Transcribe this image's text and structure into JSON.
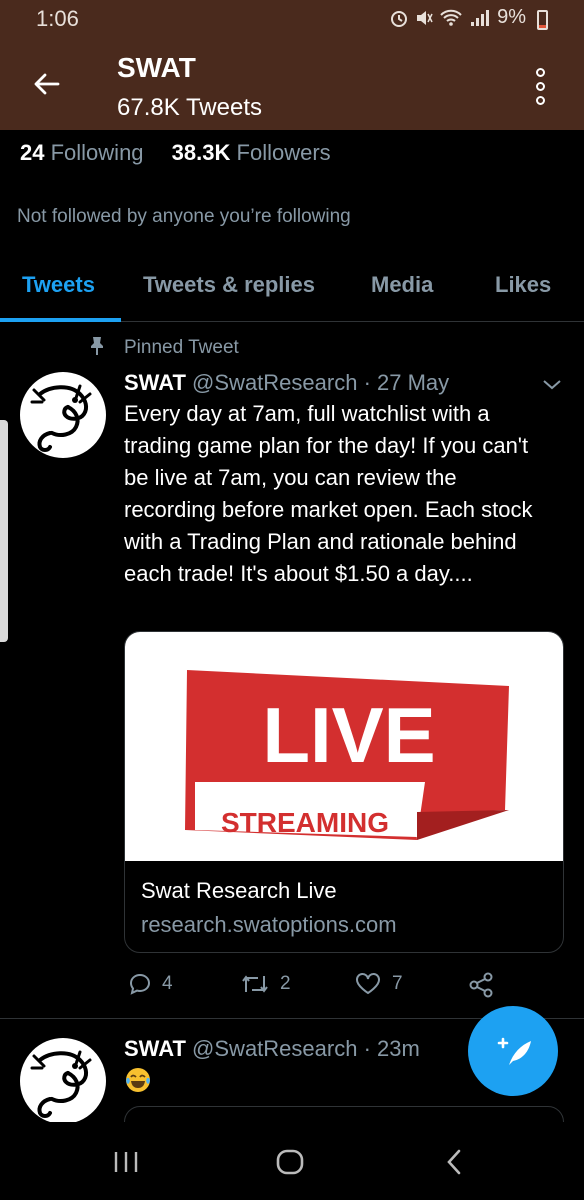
{
  "status_bar": {
    "time": "1:06",
    "battery": "9%"
  },
  "app_bar": {
    "title": "SWAT",
    "subtitle": "67.8K Tweets"
  },
  "stats": {
    "following_count": "24",
    "following_label": "Following",
    "followers_count": "38.3K",
    "followers_label": "Followers",
    "not_followed": "Not followed by anyone you’re following"
  },
  "tabs": [
    {
      "label": "Tweets",
      "active": true
    },
    {
      "label": "Tweets & replies",
      "active": false
    },
    {
      "label": "Media",
      "active": false
    },
    {
      "label": "Likes",
      "active": false
    }
  ],
  "pinned_tweet": {
    "pinned_label": "Pinned Tweet",
    "name": "SWAT",
    "handle": "@SwatResearch",
    "date": "· 27 May",
    "text": "Every day at 7am, full watchlist with a trading game plan for the day! If you can't be live at 7am, you can review the recording before market open. Each stock with a Trading Plan and rationale behind each trade! It's about $1.50 a day....",
    "card": {
      "image_line1": "LIVE",
      "image_line2": "STREAMING",
      "title": "Swat Research Live",
      "domain": "research.swatoptions.com"
    },
    "replies": "4",
    "retweets": "2",
    "likes": "7"
  },
  "second_tweet": {
    "name": "SWAT",
    "handle": "@SwatResearch",
    "time": "· 23m",
    "emoji_icon": "face-with-tears-of-joy-icon"
  },
  "colors": {
    "accent": "#1da1f2",
    "header_bg": "#4a2a1d",
    "muted": "#8899a6",
    "live_red": "#d32f2f"
  }
}
